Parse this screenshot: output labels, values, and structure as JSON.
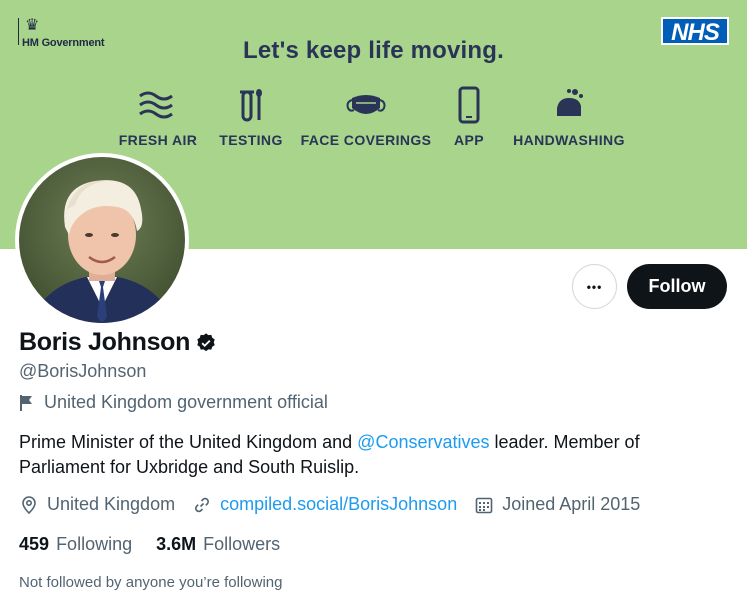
{
  "banner": {
    "background": "#a8d48c",
    "gov_logo_text": "HM Government",
    "nhs_logo_text": "NHS",
    "headline": "Let's keep life moving.",
    "measures": [
      {
        "label": "FRESH AIR",
        "icon": "wind-icon"
      },
      {
        "label": "TESTING",
        "icon": "test-tube-icon"
      },
      {
        "label": "FACE COVERINGS",
        "icon": "face-mask-icon"
      },
      {
        "label": "APP",
        "icon": "phone-icon"
      },
      {
        "label": "HANDWASHING",
        "icon": "handwashing-icon"
      }
    ]
  },
  "profile": {
    "name": "Boris Johnson",
    "verified": true,
    "handle": "@BorisJohnson",
    "affiliation_label": "United Kingdom government official",
    "bio": {
      "before": "Prime Minister of the United Kingdom and ",
      "mention": "@Conservatives",
      "after": " leader. Member of Parliament for Uxbridge and South Ruislip."
    },
    "location": "United Kingdom",
    "website": "compiled.social/BorisJohnson",
    "joined": "Joined April 2015",
    "following_count": "459",
    "following_label": "Following",
    "followers_count": "3.6M",
    "followers_label": "Followers",
    "not_followed_note": "Not followed by anyone you’re following"
  },
  "actions": {
    "more_label": "•••",
    "follow_label": "Follow"
  },
  "colors": {
    "accent": "#1d9bf0",
    "muted": "#536471",
    "text": "#0f1419",
    "nhs_blue": "#005eb8"
  }
}
